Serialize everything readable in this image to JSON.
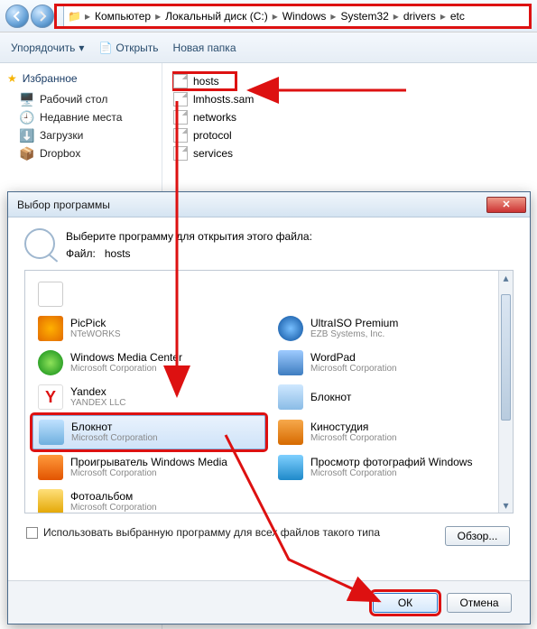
{
  "breadcrumb": {
    "items": [
      "Компьютер",
      "Локальный диск (C:)",
      "Windows",
      "System32",
      "drivers",
      "etc"
    ]
  },
  "toolbar": {
    "organize": "Упорядочить",
    "open": "Открыть",
    "newfolder": "Новая папка"
  },
  "sidebar": {
    "favorites": "Избранное",
    "items": [
      {
        "label": "Рабочий стол"
      },
      {
        "label": "Недавние места"
      },
      {
        "label": "Загрузки"
      },
      {
        "label": "Dropbox"
      }
    ]
  },
  "files": {
    "list": [
      "hosts",
      "lmhosts.sam",
      "networks",
      "protocol",
      "services"
    ]
  },
  "dialog": {
    "title": "Выбор программы",
    "headline": "Выберите программу для открытия этого файла:",
    "file_label": "Файл:",
    "file_name": "hosts",
    "checkbox": "Использовать выбранную программу для всех файлов такого типа",
    "browse": "Обзор...",
    "ok": "ОК",
    "cancel": "Отмена",
    "programs_left": [
      {
        "name": "PicPick",
        "vendor": "NTeWORKS",
        "icon": "i-picpick"
      },
      {
        "name": "Windows Media Center",
        "vendor": "Microsoft Corporation",
        "icon": "i-wmc"
      },
      {
        "name": "Yandex",
        "vendor": "YANDEX LLC",
        "icon": "i-yandex"
      },
      {
        "name": "Блокнот",
        "vendor": "Microsoft Corporation",
        "icon": "i-notepad2"
      },
      {
        "name": "Проигрыватель Windows Media",
        "vendor": "Microsoft Corporation",
        "icon": "i-wmp"
      },
      {
        "name": "Фотоальбом",
        "vendor": "Microsoft Corporation",
        "icon": "i-album"
      }
    ],
    "programs_right": [
      {
        "name": "UltraISO Premium",
        "vendor": "EZB Systems, Inc.",
        "icon": "i-ultra"
      },
      {
        "name": "WordPad",
        "vendor": "Microsoft Corporation",
        "icon": "i-wordpad"
      },
      {
        "name": "Блокнот",
        "vendor": "",
        "icon": "i-notepad"
      },
      {
        "name": "Киностудия",
        "vendor": "Microsoft Corporation",
        "icon": "i-movie"
      },
      {
        "name": "Просмотр фотографий Windows",
        "vendor": "Microsoft Corporation",
        "icon": "i-photov"
      }
    ]
  }
}
